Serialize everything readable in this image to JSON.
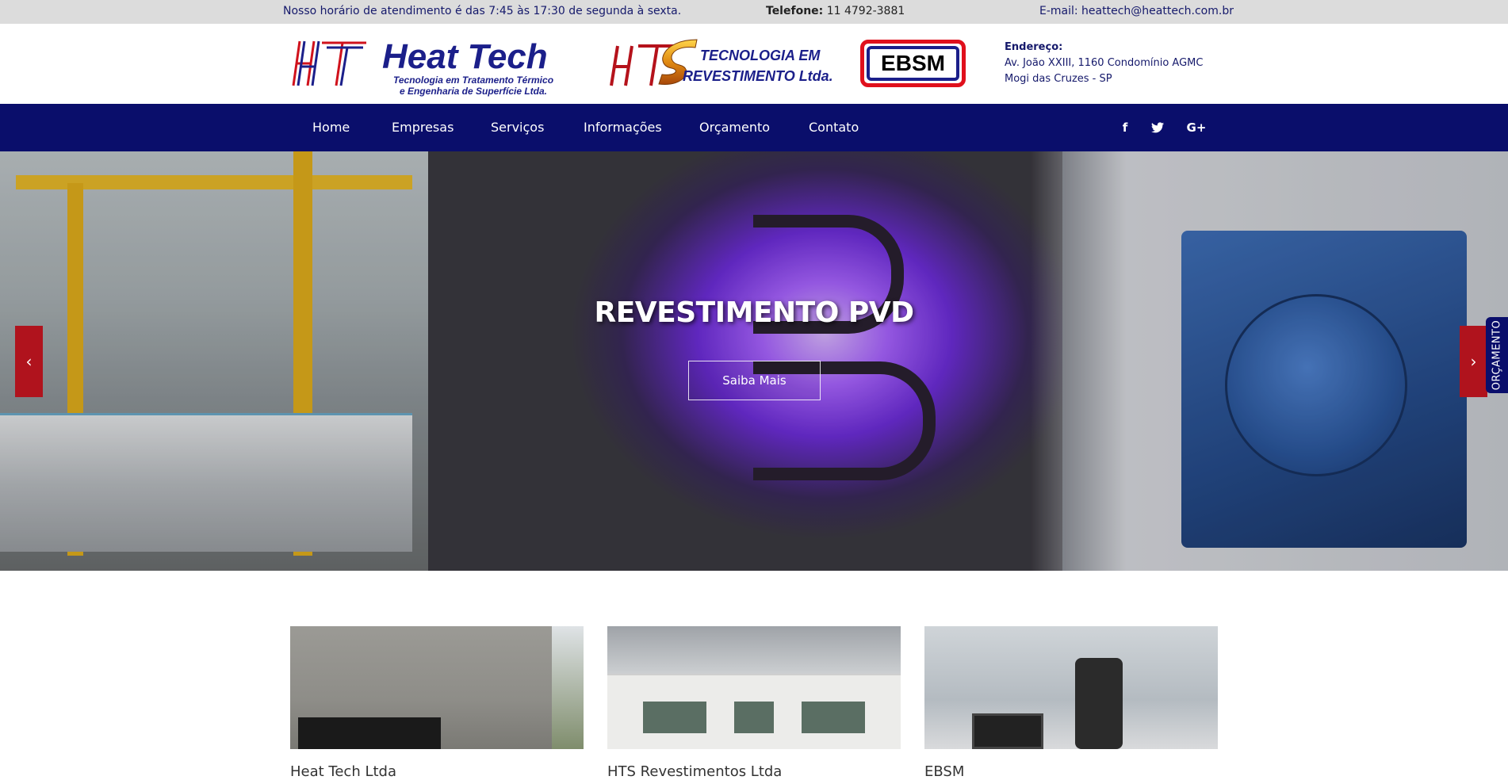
{
  "topbar": {
    "hours": "Nosso horário de atendimento é das 7:45 às 17:30 de segunda à sexta.",
    "phone_label": "Telefone:",
    "phone_value": "11 4792-3881",
    "email": "E-mail: heattech@heattech.com.br"
  },
  "logos": {
    "heattech_name": "Heat Tech",
    "heattech_sub1": "Tecnologia em Tratamento Térmico",
    "heattech_sub2": "e Engenharia de Superfície Ltda.",
    "hts_line1": "TECNOLOGIA EM",
    "hts_line2": "REVESTIMENTO Ltda.",
    "ebsm": "EBSM"
  },
  "address": {
    "label": "Endereço:",
    "line1": "Av. João XXIII, 1160 Condomínio AGMC",
    "line2": "Mogi das Cruzes - SP"
  },
  "nav": {
    "items": [
      "Home",
      "Empresas",
      "Serviços",
      "Informações",
      "Orçamento",
      "Contato"
    ],
    "social": [
      "facebook-icon",
      "twitter-icon",
      "google-plus-icon"
    ]
  },
  "hero": {
    "title": "REVESTIMENTO PVD",
    "cta": "Saiba Mais",
    "prev": "‹",
    "next": "›"
  },
  "side_tab": "ORÇAMENTO",
  "cards": [
    {
      "caption": "Heat Tech Ltda"
    },
    {
      "caption": "HTS Revestimentos Ltda"
    },
    {
      "caption": "EBSM"
    }
  ],
  "colors": {
    "nav_bg": "#0a0e6b",
    "brand_blue": "#1b1f8a",
    "accent_red": "#b0131d",
    "topbar_bg": "#dcdcdc"
  }
}
